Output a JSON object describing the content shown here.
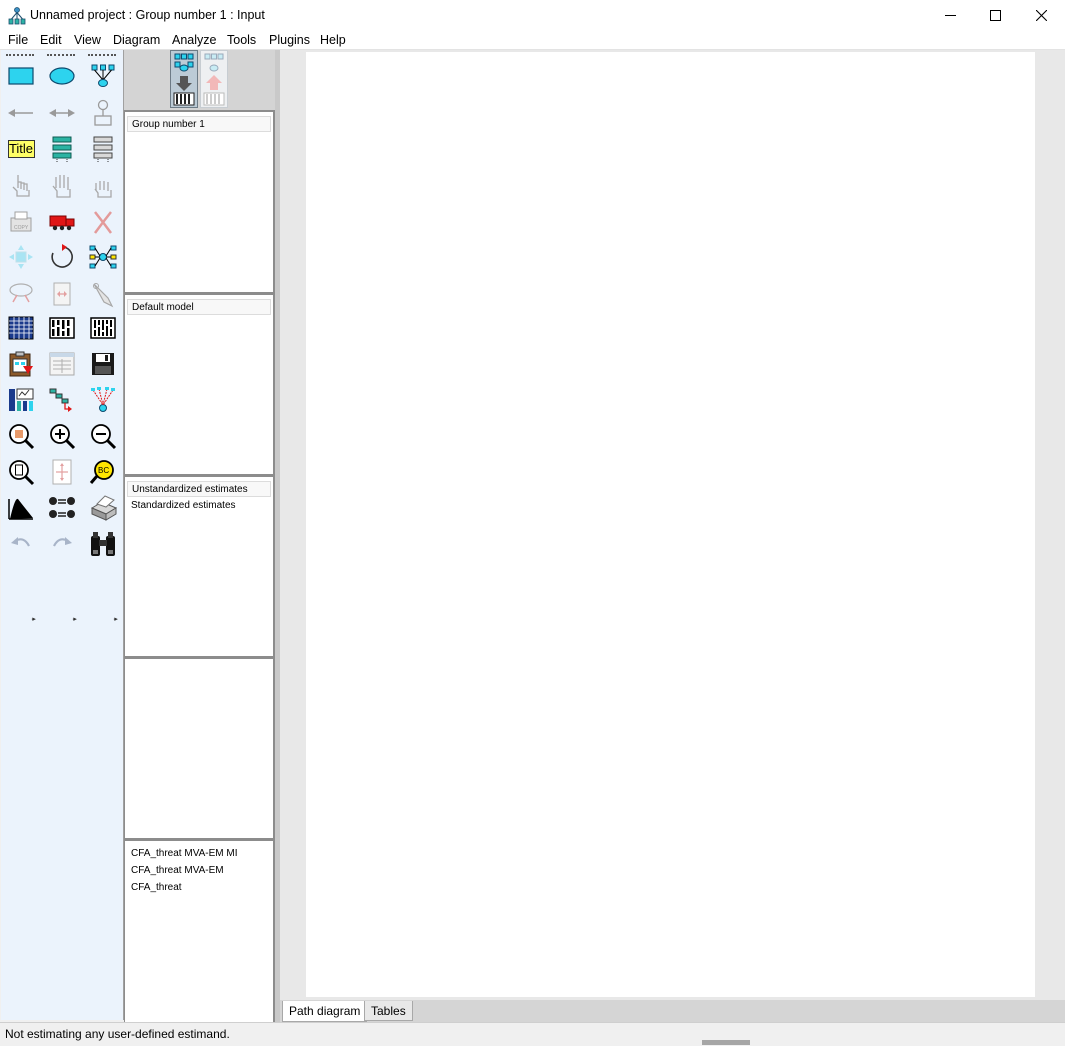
{
  "window": {
    "title": "Unnamed project : Group number 1 : Input",
    "controls": {
      "minimize": "minimize-icon",
      "maximize": "maximize-icon",
      "close": "close-icon"
    }
  },
  "menu": [
    "File",
    "Edit",
    "View",
    "Diagram",
    "Analyze",
    "Tools",
    "Plugins",
    "Help"
  ],
  "toolbox": {
    "tools": [
      {
        "name": "draw-observed-variable-tool",
        "icon": "rectangle-icon"
      },
      {
        "name": "draw-unobserved-variable-tool",
        "icon": "ellipse-icon"
      },
      {
        "name": "draw-latent-indicator-tool",
        "icon": "latent-indicator-icon"
      },
      {
        "name": "draw-path-tool",
        "icon": "single-arrow-icon"
      },
      {
        "name": "draw-covariance-tool",
        "icon": "double-arrow-icon"
      },
      {
        "name": "add-unique-variable-tool",
        "icon": "unique-variable-icon"
      },
      {
        "name": "figure-caption-tool",
        "icon": "title-icon",
        "label": "Title"
      },
      {
        "name": "list-variables-in-model-tool",
        "icon": "variables-in-model-icon"
      },
      {
        "name": "list-variables-in-dataset-tool",
        "icon": "variables-in-dataset-icon"
      },
      {
        "name": "select-one-object-tool",
        "icon": "hand-one-finger-icon"
      },
      {
        "name": "select-all-objects-tool",
        "icon": "hand-open-icon"
      },
      {
        "name": "deselect-all-tool",
        "icon": "hand-grab-icon"
      },
      {
        "name": "duplicate-objects-tool",
        "icon": "copy-machine-icon"
      },
      {
        "name": "move-objects-tool",
        "icon": "truck-icon"
      },
      {
        "name": "erase-objects-tool",
        "icon": "erase-x-icon"
      },
      {
        "name": "change-shape-tool",
        "icon": "shape-change-icon"
      },
      {
        "name": "rotate-indicators-tool",
        "icon": "rotate-icon"
      },
      {
        "name": "reflect-indicators-tool",
        "icon": "reflect-indicators-icon"
      },
      {
        "name": "move-parameter-values-tool",
        "icon": "move-parameters-icon"
      },
      {
        "name": "scroll-diagram-tool",
        "icon": "scroll-icon"
      },
      {
        "name": "touch-up-tool",
        "icon": "touch-up-icon"
      },
      {
        "name": "select-data-files-tool",
        "icon": "data-file-grid-icon"
      },
      {
        "name": "analysis-properties-tool",
        "icon": "analysis-properties-icon"
      },
      {
        "name": "calculate-estimates-tool",
        "icon": "abacus-icon"
      },
      {
        "name": "copy-diagram-to-clipboard-tool",
        "icon": "clipboard-icon"
      },
      {
        "name": "view-text-output-tool",
        "icon": "text-output-icon"
      },
      {
        "name": "save-diagram-tool",
        "icon": "floppy-disk-icon"
      },
      {
        "name": "object-properties-tool",
        "icon": "object-properties-icon"
      },
      {
        "name": "drag-properties-tool",
        "icon": "drag-properties-icon"
      },
      {
        "name": "preserve-symmetries-tool",
        "icon": "preserve-symmetries-icon"
      },
      {
        "name": "zoom-in-on-area-tool",
        "icon": "zoom-area-icon"
      },
      {
        "name": "zoom-in-tool",
        "icon": "zoom-in-icon"
      },
      {
        "name": "zoom-out-tool",
        "icon": "zoom-out-icon"
      },
      {
        "name": "view-entire-page-tool",
        "icon": "zoom-page-icon"
      },
      {
        "name": "resize-diagram-to-fit-tool",
        "icon": "fit-page-icon"
      },
      {
        "name": "magnify-tool",
        "icon": "magnify-icon"
      },
      {
        "name": "degrees-of-freedom-tool",
        "icon": "distribution-icon"
      },
      {
        "name": "multiple-group-analysis-tool",
        "icon": "multiple-group-icon"
      },
      {
        "name": "print-tool",
        "icon": "printer-icon"
      },
      {
        "name": "undo-tool",
        "icon": "undo-icon"
      },
      {
        "name": "redo-tool",
        "icon": "redo-icon"
      },
      {
        "name": "specification-search-tool",
        "icon": "binoculars-icon"
      }
    ],
    "more_indicator": "·▸"
  },
  "view_toggle": {
    "input": "view-input-icon",
    "output": "view-output-icon"
  },
  "panels": {
    "groups": {
      "items": [
        "Group number 1"
      ]
    },
    "models": {
      "items": [
        "Default model"
      ]
    },
    "parameter_formats": {
      "items": [
        "Unstandardized estimates",
        "Standardized estimates"
      ]
    },
    "computation_summary": {
      "items": []
    },
    "files": {
      "items": [
        "CFA_threat MVA-EM MI",
        "CFA_threat MVA-EM",
        "CFA_threat"
      ]
    }
  },
  "tabs": [
    "Path diagram",
    "Tables"
  ],
  "status": {
    "text": "Not estimating any user-defined estimand."
  }
}
